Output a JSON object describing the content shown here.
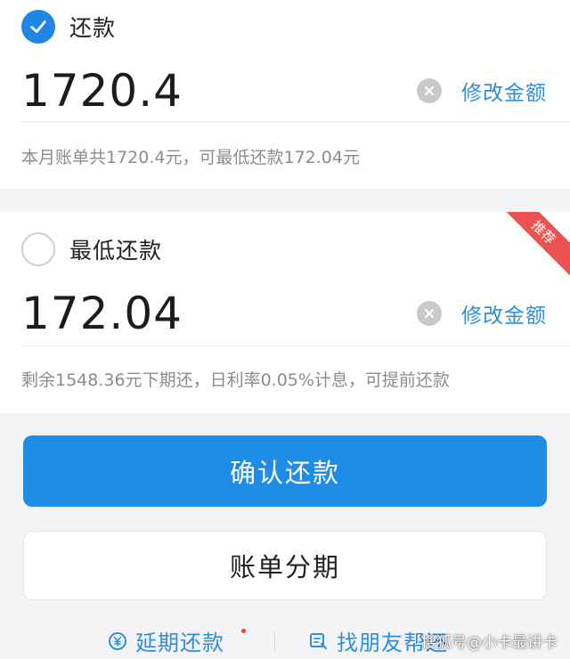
{
  "full_repay": {
    "label": "还款",
    "checked": true,
    "amount": "1720.4",
    "edit_label": "修改金额",
    "note": "本月账单共1720.4元，可最低还款172.04元"
  },
  "min_repay": {
    "label": "最低还款",
    "checked": false,
    "badge": "推荐",
    "amount": "172.04",
    "edit_label": "修改金额",
    "note": "剩余1548.36元下期还，日利率0.05%计息，可提前还款"
  },
  "buttons": {
    "confirm": "确认还款",
    "installment": "账单分期"
  },
  "bottom_links": {
    "defer": "延期还款",
    "friend_help": "找朋友帮还"
  },
  "watermark": "搜狐号@小卡最讲卡",
  "colors": {
    "accent": "#1f8de8",
    "link": "#2d8fdc",
    "badge": "#ec5252"
  }
}
